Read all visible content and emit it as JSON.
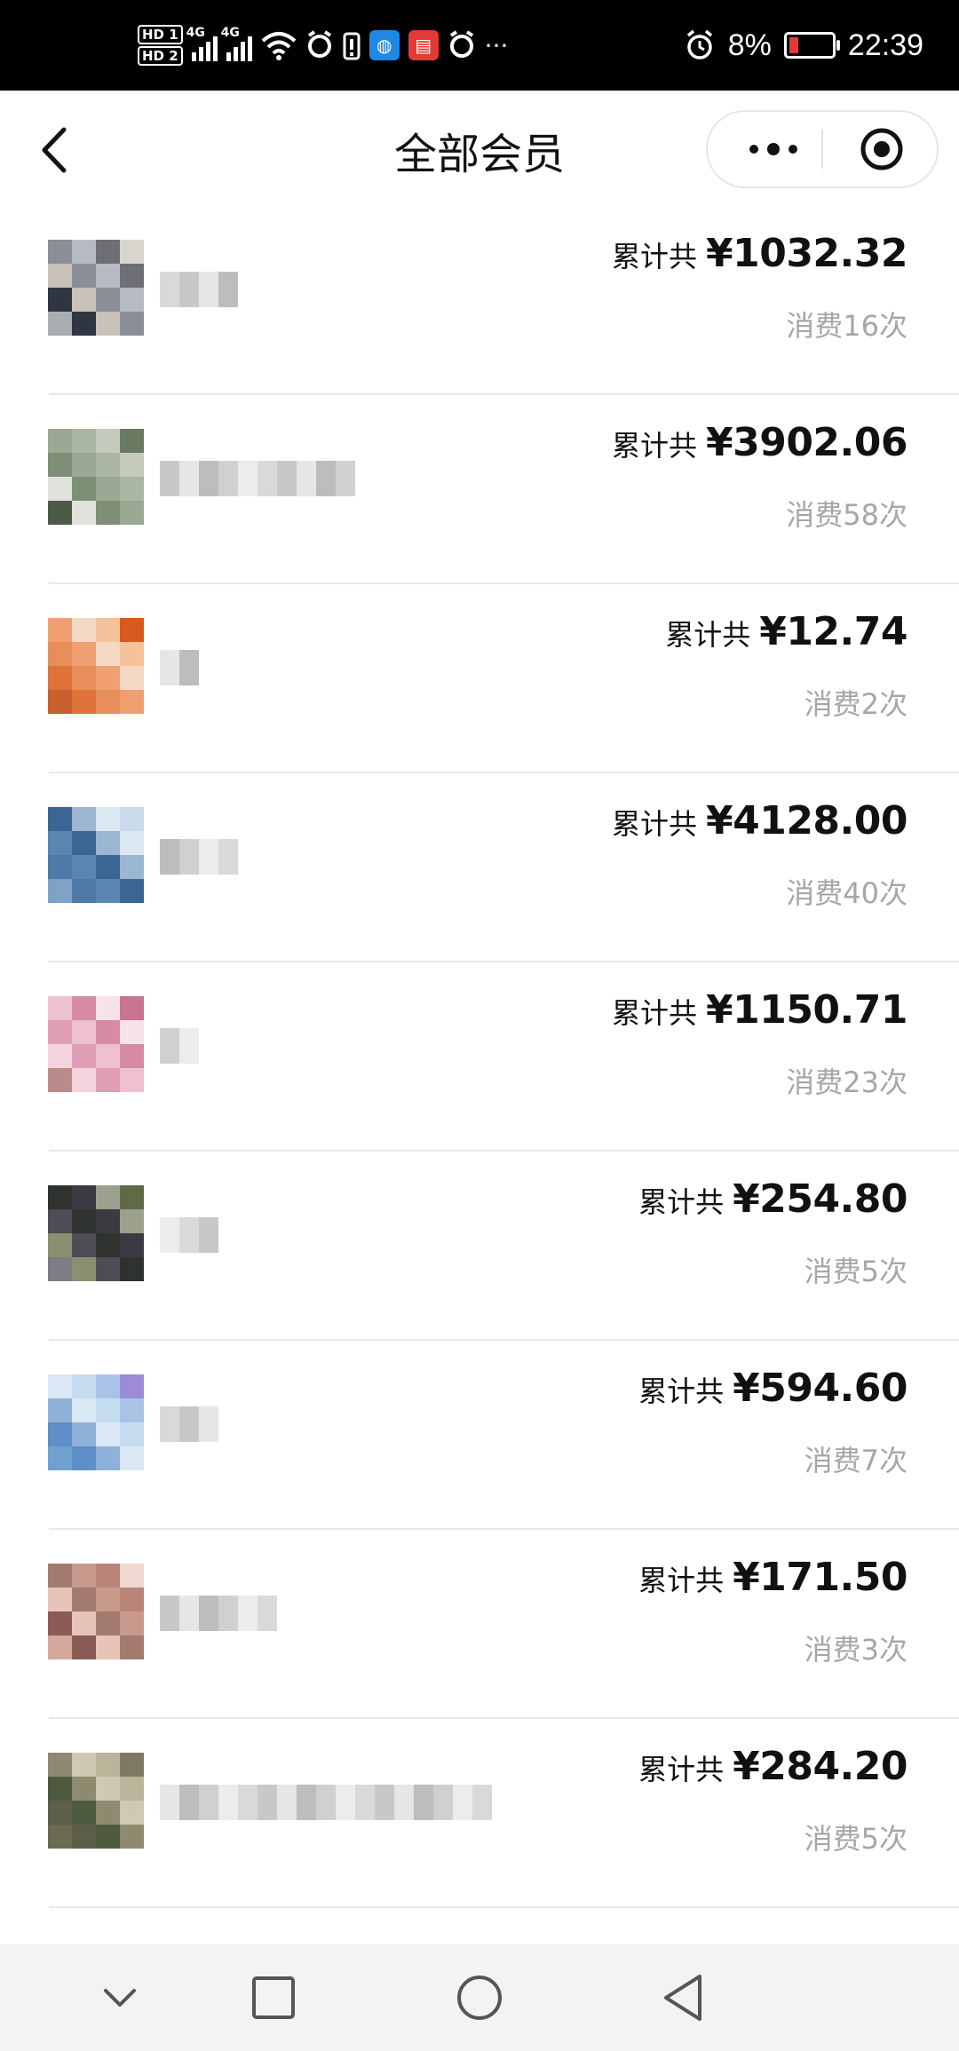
{
  "status_bar": {
    "hd1": "HD 1",
    "hd2": "HD 2",
    "net1": "4G",
    "net2": "4G",
    "more": "···",
    "battery": "8%",
    "time": "22:39",
    "icons": [
      "alarm-icon",
      "battery-icon",
      "wifi-icon",
      "app-icon"
    ]
  },
  "navbar": {
    "title": "全部会员"
  },
  "members": [
    {
      "label": "累计共",
      "amount": "¥1032.32",
      "count": "消费16次"
    },
    {
      "label": "累计共",
      "amount": "¥3902.06",
      "count": "消费58次"
    },
    {
      "label": "累计共",
      "amount": "¥12.74",
      "count": "消费2次"
    },
    {
      "label": "累计共",
      "amount": "¥4128.00",
      "count": "消费40次"
    },
    {
      "label": "累计共",
      "amount": "¥1150.71",
      "count": "消费23次"
    },
    {
      "label": "累计共",
      "amount": "¥254.80",
      "count": "消费5次"
    },
    {
      "label": "累计共",
      "amount": "¥594.60",
      "count": "消费7次"
    },
    {
      "label": "累计共",
      "amount": "¥171.50",
      "count": "消费3次"
    },
    {
      "label": "累计共",
      "amount": "¥284.20",
      "count": "消费5次"
    }
  ]
}
